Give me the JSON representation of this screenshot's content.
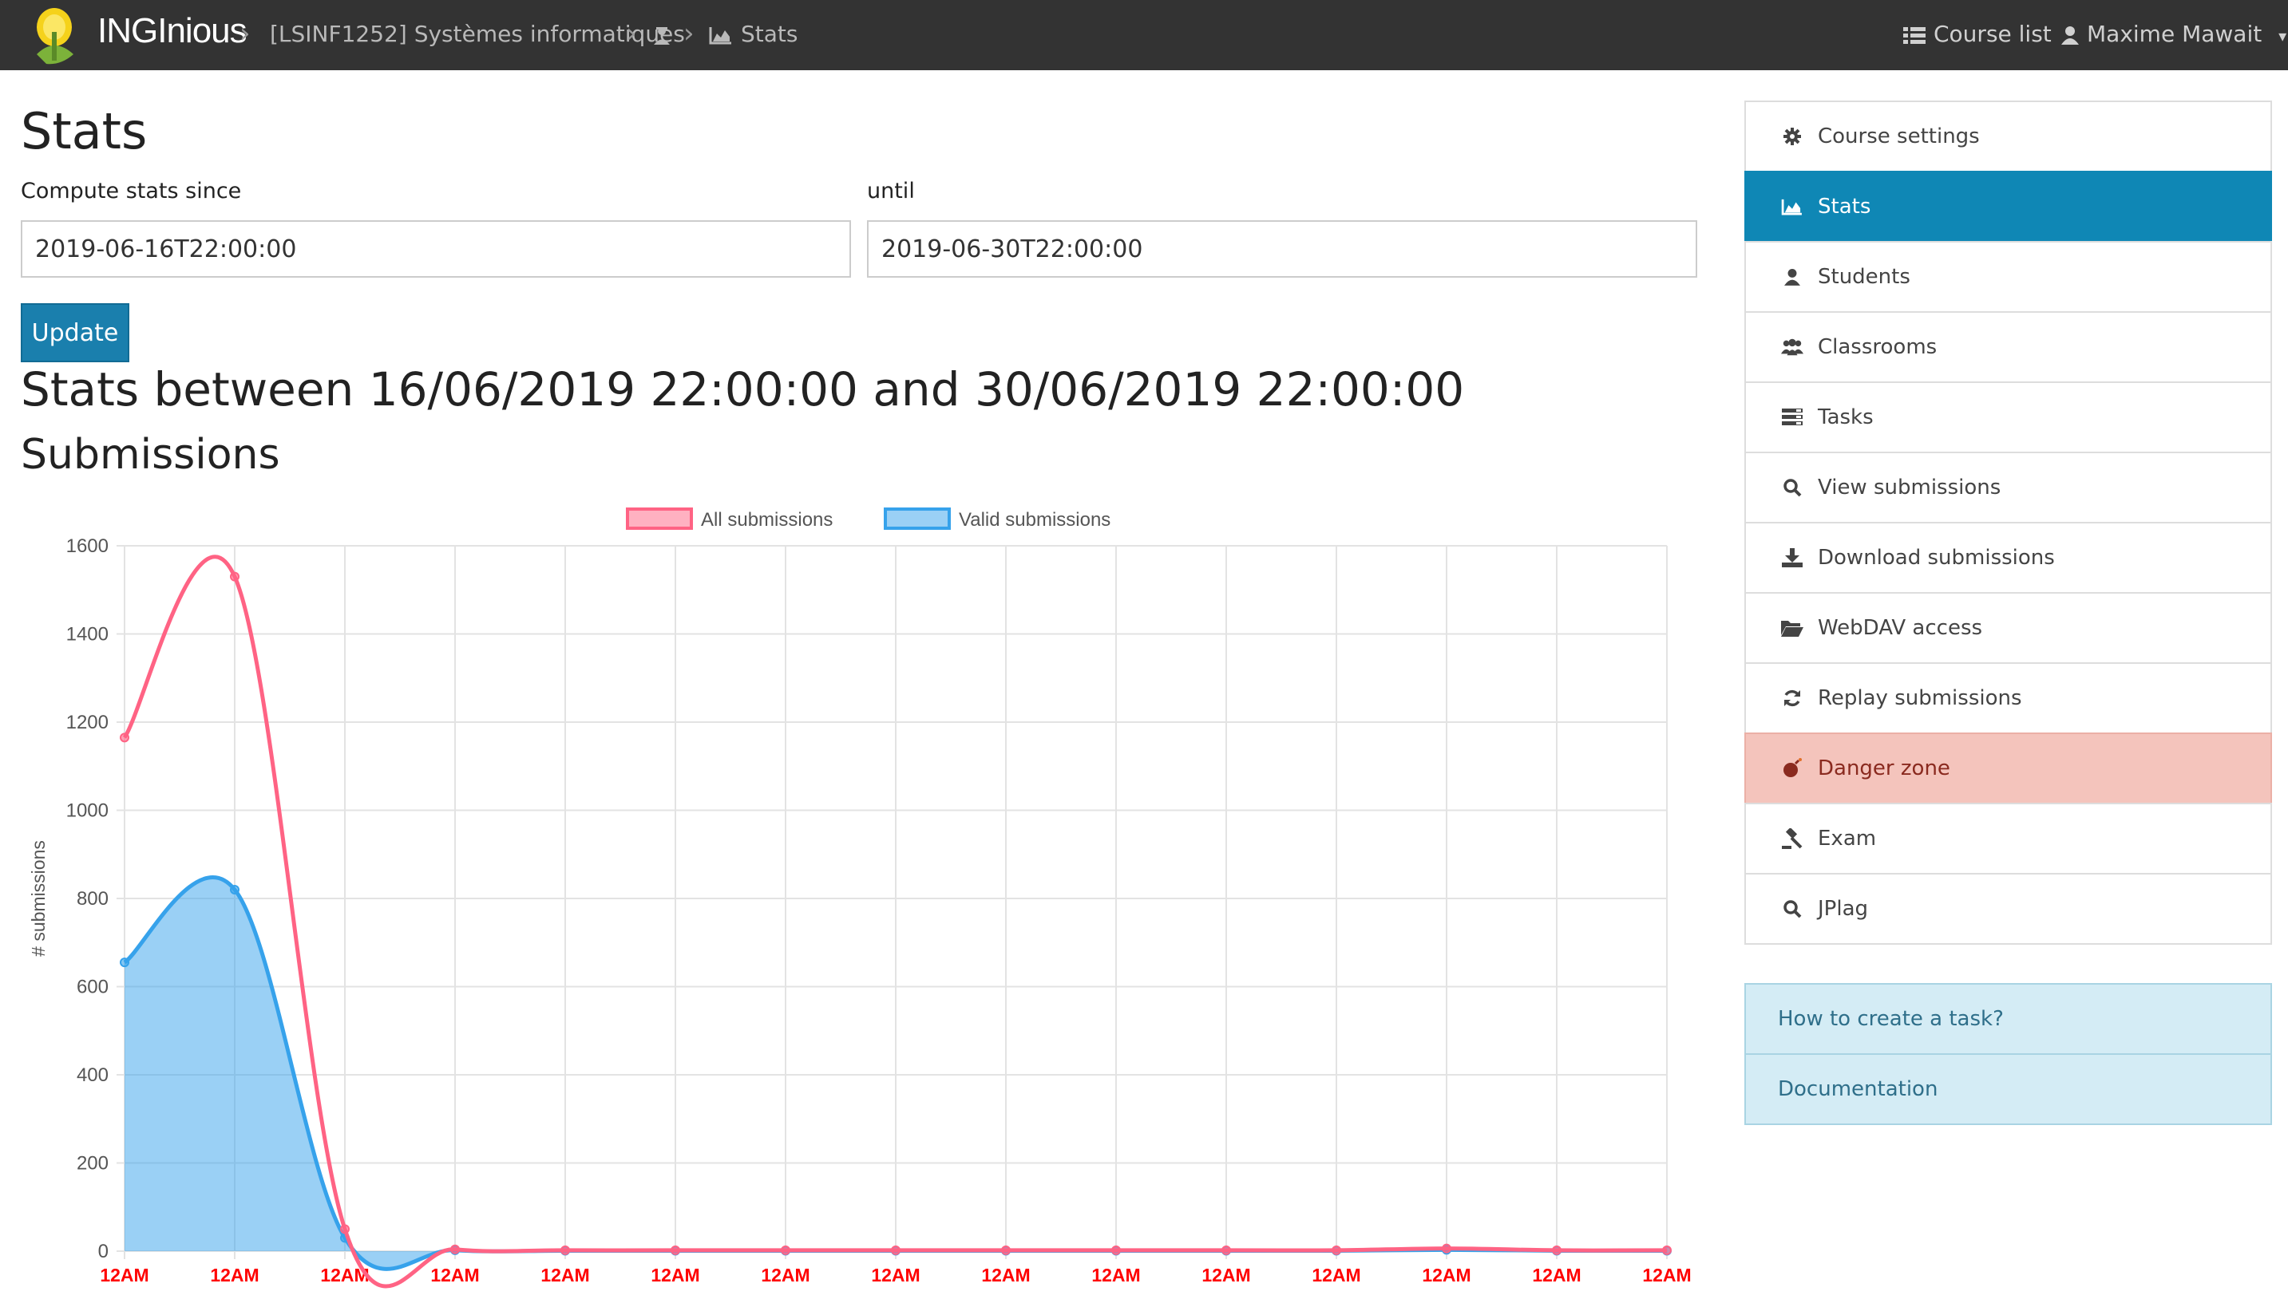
{
  "navbar": {
    "brand": "INGInious",
    "breadcrumb_course": "[LSINF1252] Systèmes informatiques",
    "breadcrumb_stats": "Stats",
    "course_list": "Course list",
    "user": "Maxime Mawait"
  },
  "page": {
    "title": "Stats",
    "since_label": "Compute stats since",
    "since_value": "2019-06-16T22:00:00",
    "until_label": "until",
    "until_value": "2019-06-30T22:00:00",
    "update_label": "Update",
    "range_heading": "Stats between 16/06/2019 22:00:00 and 30/06/2019 22:00:00",
    "submissions_heading": "Submissions"
  },
  "sidebar": {
    "items": [
      {
        "label": "Course settings",
        "icon": "gear-icon"
      },
      {
        "label": "Stats",
        "icon": "area-chart-icon",
        "active": true
      },
      {
        "label": "Students",
        "icon": "user-icon"
      },
      {
        "label": "Classrooms",
        "icon": "users-icon"
      },
      {
        "label": "Tasks",
        "icon": "tasks-icon"
      },
      {
        "label": "View submissions",
        "icon": "search-icon"
      },
      {
        "label": "Download submissions",
        "icon": "download-icon"
      },
      {
        "label": "WebDAV access",
        "icon": "folder-open-icon"
      },
      {
        "label": "Replay submissions",
        "icon": "refresh-icon"
      },
      {
        "label": "Danger zone",
        "icon": "bomb-icon",
        "danger": true
      },
      {
        "label": "Exam",
        "icon": "gavel-icon"
      },
      {
        "label": "JPlag",
        "icon": "search-icon"
      }
    ],
    "help": [
      {
        "label": "How to create a task?"
      },
      {
        "label": "Documentation"
      }
    ]
  },
  "colors": {
    "navbar": "#333333",
    "accent": "#0f87b5",
    "danger_bg": "#f4c4bc",
    "help_bg": "#d4ecf5",
    "all_submissions": "#ff6384",
    "valid_submissions": "#36a2eb",
    "tick_label": "#ff0000"
  },
  "chart_data": {
    "type": "line",
    "title": "",
    "xlabel": "",
    "ylabel": "# submissions",
    "ylim": [
      0,
      1600
    ],
    "yticks": [
      0,
      200,
      400,
      600,
      800,
      1000,
      1200,
      1400,
      1600
    ],
    "legend_position": "top",
    "grid": true,
    "categories": [
      "12AM",
      "12AM",
      "12AM",
      "12AM",
      "12AM",
      "12AM",
      "12AM",
      "12AM",
      "12AM",
      "12AM",
      "12AM",
      "12AM",
      "12AM",
      "12AM",
      "12AM"
    ],
    "series": [
      {
        "name": "All submissions",
        "color": "#ff6384",
        "fill": false,
        "values": [
          1165,
          1530,
          50,
          4,
          2,
          2,
          2,
          2,
          2,
          2,
          2,
          2,
          6,
          2,
          2
        ]
      },
      {
        "name": "Valid submissions",
        "color": "#36a2eb",
        "fill": true,
        "values": [
          655,
          820,
          30,
          2,
          1,
          1,
          1,
          1,
          1,
          1,
          1,
          1,
          3,
          1,
          1
        ]
      }
    ]
  }
}
